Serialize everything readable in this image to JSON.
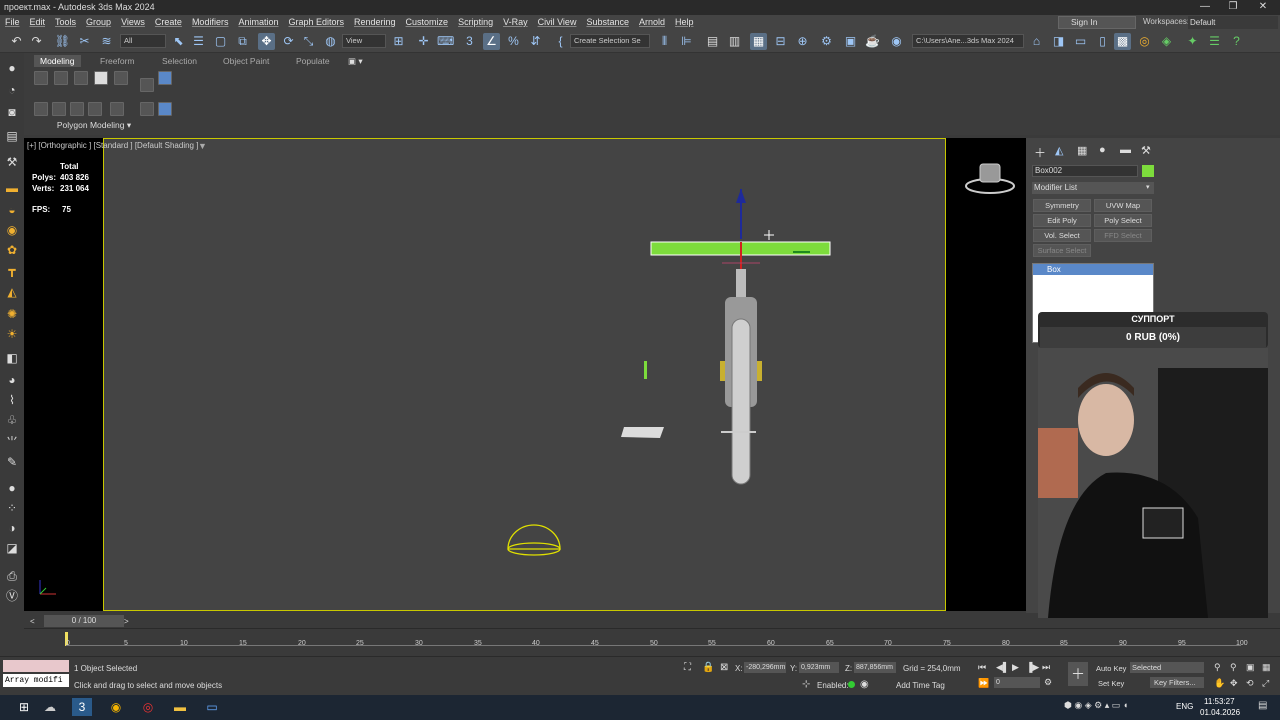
{
  "title": "проект.max - Autodesk 3ds Max 2024",
  "window_buttons": [
    "—",
    "❐",
    "✕"
  ],
  "menu": [
    "File",
    "Edit",
    "Tools",
    "Group",
    "Views",
    "Create",
    "Modifiers",
    "Animation",
    "Graph Editors",
    "Rendering",
    "Customize",
    "Scripting",
    "V-Ray",
    "Civil View",
    "Substance",
    "Arnold",
    "Help"
  ],
  "signin": "Sign In",
  "workspaces_label": "Workspaces:",
  "workspaces_value": "Default",
  "toolbar": {
    "filter": "All",
    "coord": "View",
    "selection_set": "Create Selection Se",
    "path": "C:\\Users\\Ane...3ds Max 2024"
  },
  "ribbon": {
    "tabs": [
      "Modeling",
      "Freeform",
      "Selection",
      "Object Paint",
      "Populate"
    ],
    "active_tab": "Modeling",
    "panel_label": "Polygon Modeling"
  },
  "viewport": {
    "label": "[+] [Orthographic ] [Standard ] [Default Shading ]",
    "stats_total": "Total",
    "polys_label": "Polys:",
    "polys_value": "403 826",
    "verts_label": "Verts:",
    "verts_value": "231 064",
    "fps_label": "FPS:",
    "fps_value": "75"
  },
  "command_panel": {
    "object_name": "Box002",
    "object_color": "#7ddc3c",
    "modifier_list": "Modifier List",
    "buttons": [
      "Symmetry",
      "UVW Map",
      "Edit Poly",
      "Poly Select",
      "Vol. Select",
      "FFD Select",
      "Surface Select"
    ],
    "stack_item": "Box"
  },
  "support": {
    "title": "СУППОРТ",
    "amount": "0 RUB (0%)",
    "progress": 0,
    "min": "0",
    "max": "100"
  },
  "timeline": {
    "frame": "0 / 100",
    "ticks": [
      "0",
      "5",
      "10",
      "15",
      "20",
      "25",
      "30",
      "35",
      "40",
      "45",
      "50",
      "55",
      "60",
      "65",
      "70",
      "75",
      "80",
      "85",
      "90",
      "95",
      "100"
    ]
  },
  "status": {
    "maxscript": "Array modifi",
    "selected": "1 Object Selected",
    "prompt": "Click and drag to select and move objects",
    "x_label": "X:",
    "x_value": "-280,296mm",
    "y_label": "Y:",
    "y_value": "0,923mm",
    "z_label": "Z:",
    "z_value": "887,856mm",
    "grid": "Grid = 254,0mm",
    "enabled": "Enabled:",
    "add_time_tag": "Add Time Tag",
    "frame_input": "0",
    "auto_key": "Auto Key",
    "set_key": "Set Key",
    "selected_dd": "Selected",
    "key_filters": "Key Filters..."
  },
  "taskbar": {
    "lang": "ENG",
    "time": "11:53:27",
    "date": "01.04.2026"
  },
  "colors": {
    "viewport_border": "#c8c800",
    "selection_highlight": "#7ddc3c",
    "accent": "#5a88c8"
  }
}
